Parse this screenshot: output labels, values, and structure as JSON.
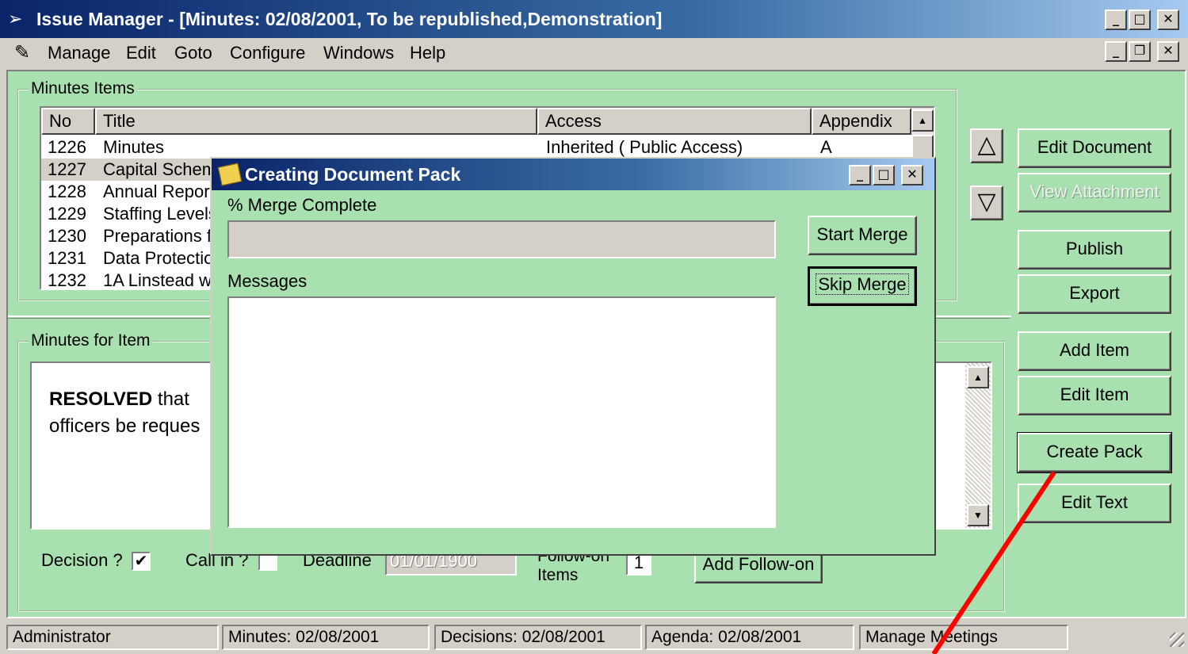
{
  "window": {
    "title": "Issue Manager - [Minutes: 02/08/2001, To be republished,Demonstration]",
    "min": "_",
    "max": "□",
    "close": "✕",
    "restore": "❐"
  },
  "menu": {
    "items": [
      "Manage",
      "Edit",
      "Goto",
      "Configure",
      "Windows",
      "Help"
    ]
  },
  "minutes_items": {
    "legend": "Minutes Items",
    "columns": [
      "No",
      "Title",
      "Access",
      "Appendix"
    ],
    "rows": [
      {
        "no": "1226",
        "title": "Minutes",
        "access": "Inherited ( Public Access)",
        "appendix": "A"
      },
      {
        "no": "1227",
        "title": "Capital Schem",
        "access": "",
        "appendix": ""
      },
      {
        "no": "1228",
        "title": "Annual Report",
        "access": "",
        "appendix": ""
      },
      {
        "no": "1229",
        "title": "Staffing Levels",
        "access": "",
        "appendix": ""
      },
      {
        "no": "1230",
        "title": "Preparations f",
        "access": "",
        "appendix": ""
      },
      {
        "no": "1231",
        "title": "Data Protectio",
        "access": "",
        "appendix": ""
      },
      {
        "no": "1232",
        "title": "1A Linstead w",
        "access": "",
        "appendix": ""
      }
    ]
  },
  "minutes_for_item": {
    "legend": "Minutes for Item",
    "text_bold": "RESOLVED",
    "text_rest": " that",
    "text_line2": "officers be reques"
  },
  "bottom_controls": {
    "decision_label": "Decision ?",
    "decision_checked": "✔",
    "callin_label": "Call in ?",
    "deadline_label": "Deadline",
    "deadline_value": "01/01/1900",
    "followon_label_line1": "Follow-on",
    "followon_label_line2": "Items",
    "followon_value": "1",
    "add_followon": "Add Follow-on"
  },
  "side_buttons": {
    "edit_document": "Edit Document",
    "view_attachment": "View Attachment",
    "publish": "Publish",
    "export": "Export",
    "add_item": "Add Item",
    "edit_item": "Edit Item",
    "create_pack": "Create Pack",
    "edit_text": "Edit Text"
  },
  "dialog": {
    "title": "Creating Document Pack",
    "merge_label": "% Merge Complete",
    "merge_progress": 0,
    "messages_label": "Messages",
    "start_merge": "Start Merge",
    "skip_merge": "Skip Merge"
  },
  "status": {
    "user": "Administrator",
    "minutes": "Minutes: 02/08/2001",
    "decisions": "Decisions: 02/08/2001",
    "agenda": "Agenda: 02/08/2001",
    "mode": "Manage Meetings"
  },
  "colors": {
    "panel": "#a8e0b0",
    "title_gradient_start": "#0a246a",
    "annotation": "#ff0000"
  },
  "icons": [
    "app-arrow-icon",
    "mdi-doc-icon",
    "dialog-pack-icon",
    "arrow-up-icon",
    "arrow-down-icon"
  ]
}
